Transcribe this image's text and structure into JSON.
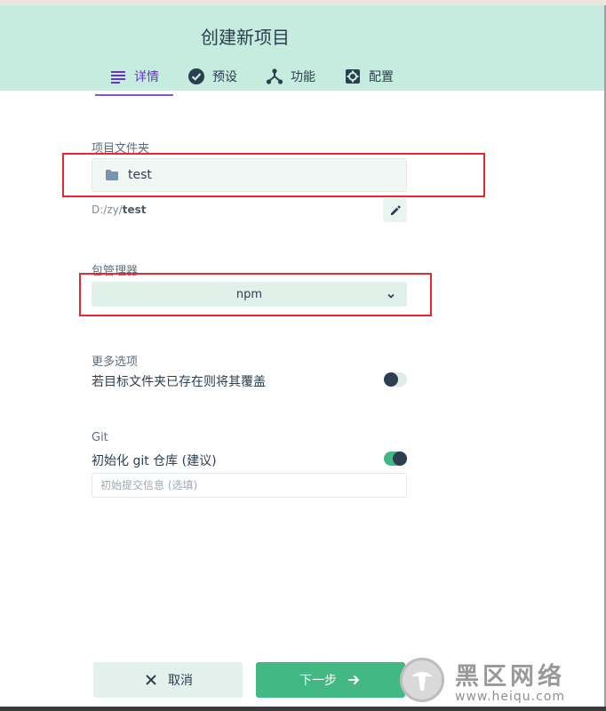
{
  "header": {
    "title": "创建新项目",
    "tabs": [
      {
        "label": "详情",
        "icon": "list-icon",
        "active": true
      },
      {
        "label": "预设",
        "icon": "check-circle-icon",
        "active": false
      },
      {
        "label": "功能",
        "icon": "fork-icon",
        "active": false
      },
      {
        "label": "配置",
        "icon": "settings-icon",
        "active": false
      }
    ]
  },
  "folder": {
    "label": "项目文件夹",
    "value": "test",
    "path_prefix": "D:/zy/",
    "path_name": "test"
  },
  "package_manager": {
    "label": "包管理器",
    "value": "npm"
  },
  "more_options": {
    "label": "更多选项",
    "overwrite_label": "若目标文件夹已存在则将其覆盖",
    "overwrite_enabled": false
  },
  "git": {
    "label": "Git",
    "init_label": "初始化 git 仓库 (建议)",
    "init_enabled": true,
    "commit_placeholder": "初始提交信息 (选填)"
  },
  "actions": {
    "cancel_label": "取消",
    "next_label": "下一步"
  },
  "watermark": {
    "text": "黑区网络",
    "url": "www.heiqu.com"
  },
  "colors": {
    "header_bg": "#c6ebdf",
    "accent_green": "#42b983",
    "accent_purple": "#7e57c2",
    "highlight_red": "#e8282e"
  }
}
